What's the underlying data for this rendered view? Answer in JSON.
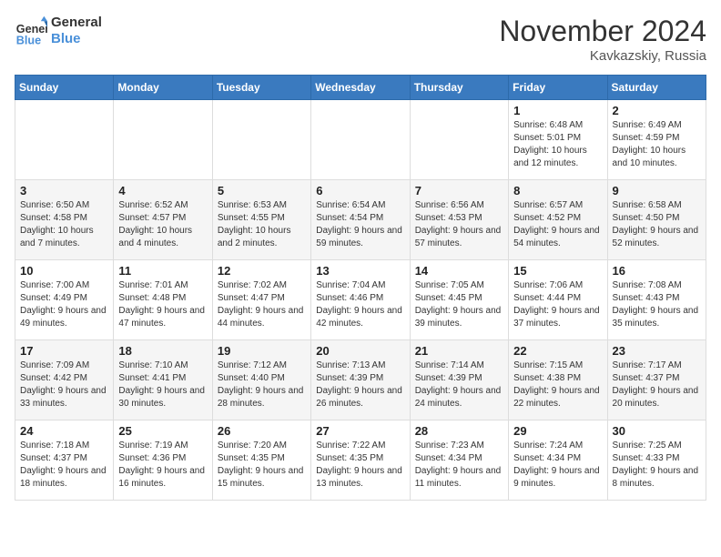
{
  "header": {
    "logo_line1": "General",
    "logo_line2": "Blue",
    "month": "November 2024",
    "location": "Kavkazskiy, Russia"
  },
  "columns": [
    "Sunday",
    "Monday",
    "Tuesday",
    "Wednesday",
    "Thursday",
    "Friday",
    "Saturday"
  ],
  "rows": [
    [
      {
        "day": "",
        "info": ""
      },
      {
        "day": "",
        "info": ""
      },
      {
        "day": "",
        "info": ""
      },
      {
        "day": "",
        "info": ""
      },
      {
        "day": "",
        "info": ""
      },
      {
        "day": "1",
        "info": "Sunrise: 6:48 AM\nSunset: 5:01 PM\nDaylight: 10 hours and 12 minutes."
      },
      {
        "day": "2",
        "info": "Sunrise: 6:49 AM\nSunset: 4:59 PM\nDaylight: 10 hours and 10 minutes."
      }
    ],
    [
      {
        "day": "3",
        "info": "Sunrise: 6:50 AM\nSunset: 4:58 PM\nDaylight: 10 hours and 7 minutes."
      },
      {
        "day": "4",
        "info": "Sunrise: 6:52 AM\nSunset: 4:57 PM\nDaylight: 10 hours and 4 minutes."
      },
      {
        "day": "5",
        "info": "Sunrise: 6:53 AM\nSunset: 4:55 PM\nDaylight: 10 hours and 2 minutes."
      },
      {
        "day": "6",
        "info": "Sunrise: 6:54 AM\nSunset: 4:54 PM\nDaylight: 9 hours and 59 minutes."
      },
      {
        "day": "7",
        "info": "Sunrise: 6:56 AM\nSunset: 4:53 PM\nDaylight: 9 hours and 57 minutes."
      },
      {
        "day": "8",
        "info": "Sunrise: 6:57 AM\nSunset: 4:52 PM\nDaylight: 9 hours and 54 minutes."
      },
      {
        "day": "9",
        "info": "Sunrise: 6:58 AM\nSunset: 4:50 PM\nDaylight: 9 hours and 52 minutes."
      }
    ],
    [
      {
        "day": "10",
        "info": "Sunrise: 7:00 AM\nSunset: 4:49 PM\nDaylight: 9 hours and 49 minutes."
      },
      {
        "day": "11",
        "info": "Sunrise: 7:01 AM\nSunset: 4:48 PM\nDaylight: 9 hours and 47 minutes."
      },
      {
        "day": "12",
        "info": "Sunrise: 7:02 AM\nSunset: 4:47 PM\nDaylight: 9 hours and 44 minutes."
      },
      {
        "day": "13",
        "info": "Sunrise: 7:04 AM\nSunset: 4:46 PM\nDaylight: 9 hours and 42 minutes."
      },
      {
        "day": "14",
        "info": "Sunrise: 7:05 AM\nSunset: 4:45 PM\nDaylight: 9 hours and 39 minutes."
      },
      {
        "day": "15",
        "info": "Sunrise: 7:06 AM\nSunset: 4:44 PM\nDaylight: 9 hours and 37 minutes."
      },
      {
        "day": "16",
        "info": "Sunrise: 7:08 AM\nSunset: 4:43 PM\nDaylight: 9 hours and 35 minutes."
      }
    ],
    [
      {
        "day": "17",
        "info": "Sunrise: 7:09 AM\nSunset: 4:42 PM\nDaylight: 9 hours and 33 minutes."
      },
      {
        "day": "18",
        "info": "Sunrise: 7:10 AM\nSunset: 4:41 PM\nDaylight: 9 hours and 30 minutes."
      },
      {
        "day": "19",
        "info": "Sunrise: 7:12 AM\nSunset: 4:40 PM\nDaylight: 9 hours and 28 minutes."
      },
      {
        "day": "20",
        "info": "Sunrise: 7:13 AM\nSunset: 4:39 PM\nDaylight: 9 hours and 26 minutes."
      },
      {
        "day": "21",
        "info": "Sunrise: 7:14 AM\nSunset: 4:39 PM\nDaylight: 9 hours and 24 minutes."
      },
      {
        "day": "22",
        "info": "Sunrise: 7:15 AM\nSunset: 4:38 PM\nDaylight: 9 hours and 22 minutes."
      },
      {
        "day": "23",
        "info": "Sunrise: 7:17 AM\nSunset: 4:37 PM\nDaylight: 9 hours and 20 minutes."
      }
    ],
    [
      {
        "day": "24",
        "info": "Sunrise: 7:18 AM\nSunset: 4:37 PM\nDaylight: 9 hours and 18 minutes."
      },
      {
        "day": "25",
        "info": "Sunrise: 7:19 AM\nSunset: 4:36 PM\nDaylight: 9 hours and 16 minutes."
      },
      {
        "day": "26",
        "info": "Sunrise: 7:20 AM\nSunset: 4:35 PM\nDaylight: 9 hours and 15 minutes."
      },
      {
        "day": "27",
        "info": "Sunrise: 7:22 AM\nSunset: 4:35 PM\nDaylight: 9 hours and 13 minutes."
      },
      {
        "day": "28",
        "info": "Sunrise: 7:23 AM\nSunset: 4:34 PM\nDaylight: 9 hours and 11 minutes."
      },
      {
        "day": "29",
        "info": "Sunrise: 7:24 AM\nSunset: 4:34 PM\nDaylight: 9 hours and 9 minutes."
      },
      {
        "day": "30",
        "info": "Sunrise: 7:25 AM\nSunset: 4:33 PM\nDaylight: 9 hours and 8 minutes."
      }
    ]
  ]
}
